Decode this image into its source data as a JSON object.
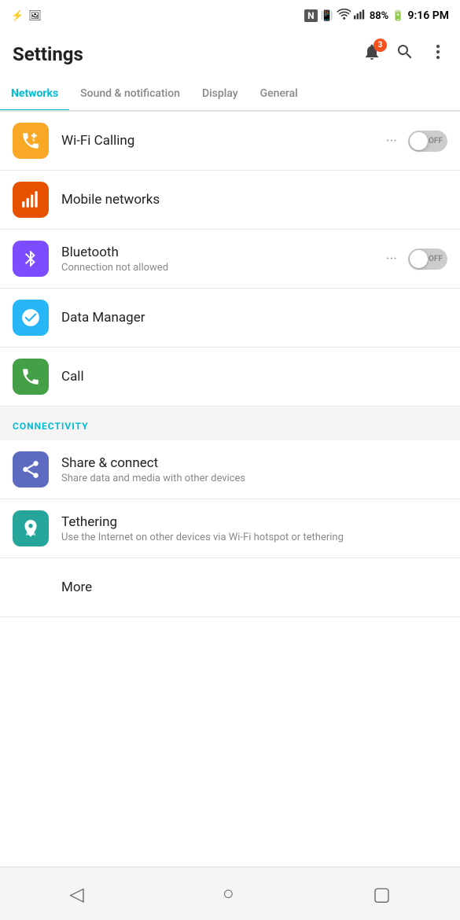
{
  "statusBar": {
    "leftIcons": [
      "usb-icon",
      "image-icon"
    ],
    "nfc": "N",
    "vibrate": "🔳",
    "wifi": "wifi-icon",
    "signal": "signal-icon",
    "battery": "88%",
    "time": "9:16 PM"
  },
  "header": {
    "title": "Settings",
    "badge": "3"
  },
  "tabs": [
    {
      "label": "Networks",
      "active": true
    },
    {
      "label": "Sound & notification",
      "active": false
    },
    {
      "label": "Display",
      "active": false
    },
    {
      "label": "General",
      "active": false
    }
  ],
  "settingsItems": [
    {
      "id": "wifi-calling",
      "title": "Wi-Fi Calling",
      "subtitle": "",
      "iconColor": "yellow",
      "hasToggle": true,
      "toggleState": "OFF",
      "hasMenu": true
    },
    {
      "id": "mobile-networks",
      "title": "Mobile networks",
      "subtitle": "",
      "iconColor": "orange",
      "hasToggle": false,
      "hasMenu": false
    },
    {
      "id": "bluetooth",
      "title": "Bluetooth",
      "subtitle": "Connection not allowed",
      "iconColor": "purple",
      "hasToggle": true,
      "toggleState": "OFF",
      "hasMenu": true
    },
    {
      "id": "data-manager",
      "title": "Data Manager",
      "subtitle": "",
      "iconColor": "blue-light",
      "hasToggle": false,
      "hasMenu": false
    },
    {
      "id": "call",
      "title": "Call",
      "subtitle": "",
      "iconColor": "green",
      "hasToggle": false,
      "hasMenu": false
    }
  ],
  "connectivity": {
    "sectionLabel": "CONNECTIVITY",
    "items": [
      {
        "id": "share-connect",
        "title": "Share & connect",
        "subtitle": "Share data and media with other devices",
        "iconColor": "blue-mid",
        "hasToggle": false,
        "hasMenu": false
      },
      {
        "id": "tethering",
        "title": "Tethering",
        "subtitle": "Use the Internet on other devices via Wi-Fi hotspot or tethering",
        "iconColor": "teal",
        "hasToggle": false,
        "hasMenu": false
      },
      {
        "id": "more",
        "title": "More",
        "subtitle": "",
        "iconColor": "",
        "hasToggle": false,
        "hasMenu": false
      }
    ]
  },
  "bottomNav": {
    "back": "◁",
    "home": "○",
    "recent": "▢"
  }
}
